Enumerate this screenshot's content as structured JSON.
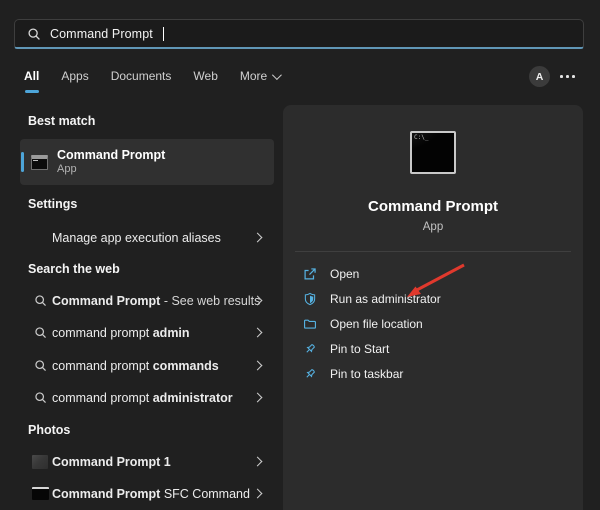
{
  "search": {
    "value": "Command Prompt"
  },
  "tabs": {
    "all": "All",
    "apps": "Apps",
    "documents": "Documents",
    "web": "Web",
    "more": "More",
    "active": "All"
  },
  "account": {
    "avatar_letter": "A"
  },
  "sections": {
    "best_match": {
      "header": "Best match",
      "title": "Command Prompt",
      "subtitle": "App"
    },
    "settings": {
      "header": "Settings",
      "item": "Manage app execution aliases"
    },
    "search_web": {
      "header": "Search the web",
      "items": [
        {
          "prefix": "",
          "bold": "Command Prompt",
          "suffix": " - See web results"
        },
        {
          "prefix": "command prompt ",
          "bold": "admin",
          "suffix": ""
        },
        {
          "prefix": "command prompt ",
          "bold": "commands",
          "suffix": ""
        },
        {
          "prefix": "command prompt ",
          "bold": "administrator",
          "suffix": ""
        }
      ]
    },
    "photos": {
      "header": "Photos",
      "items": [
        {
          "bold": "Command Prompt 1",
          "rest": ""
        },
        {
          "bold": "Command Prompt",
          "rest": " SFC Command"
        }
      ]
    }
  },
  "panel": {
    "title": "Command Prompt",
    "subtitle": "App",
    "actions": [
      {
        "label": "Open",
        "icon": "open-external-icon"
      },
      {
        "label": "Run as administrator",
        "icon": "shield-icon"
      },
      {
        "label": "Open file location",
        "icon": "folder-icon"
      },
      {
        "label": "Pin to Start",
        "icon": "pin-icon"
      },
      {
        "label": "Pin to taskbar",
        "icon": "pin-icon"
      }
    ]
  },
  "annotation": {
    "type": "arrow",
    "points_at": "Run as administrator",
    "color": "#e0392d"
  },
  "colors": {
    "background": "#202020",
    "panel": "#2c2c2c",
    "accent": "#4da5d9",
    "action_icon": "#56b2e2",
    "search_underline": "#6096b6"
  }
}
